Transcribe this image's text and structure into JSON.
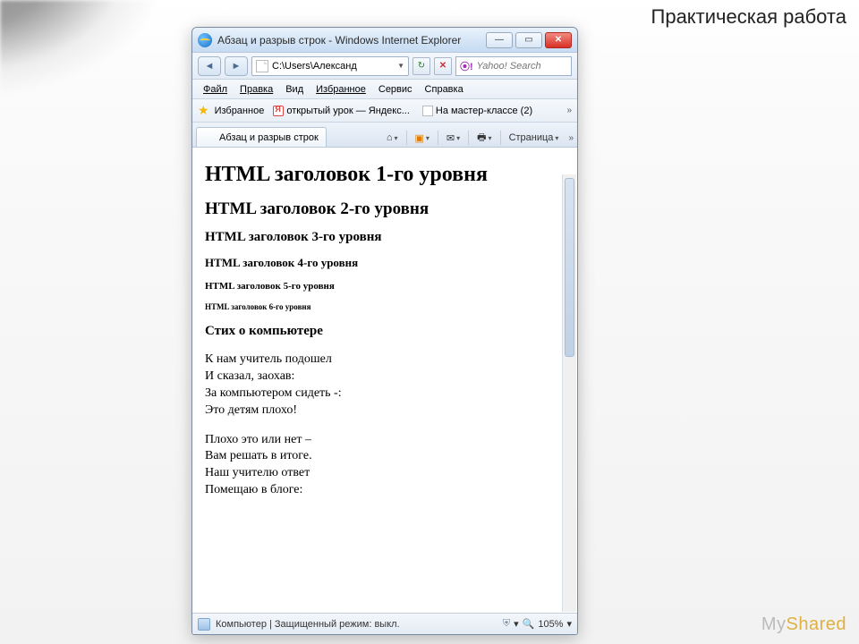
{
  "slide": {
    "title": "Практическая работа",
    "watermark_a": "My",
    "watermark_b": "Shared"
  },
  "window": {
    "title": "Абзац и разрыв строк - Windows Internet Explorer",
    "address": "C:\\Users\\Александ",
    "search_placeholder": "Yahoo! Search"
  },
  "menu": {
    "file": "Файл",
    "edit": "Правка",
    "view": "Вид",
    "fav": "Избранное",
    "tools": "Сервис",
    "help": "Справка"
  },
  "favbar": {
    "label": "Избранное",
    "link1": "открытый урок — Яндекс...",
    "link2": "На мастер-классе (2)"
  },
  "tab": {
    "title": "Абзац и разрыв строк",
    "page_btn": "Страница"
  },
  "page": {
    "h1": "HTML заголовок 1-го уровня",
    "h2": "HTML заголовок 2-го уровня",
    "h3": "HTML заголовок 3-го уровня",
    "h4": "HTML заголовок 4-го уровня",
    "h5": "HTML заголовок 5-го уровня",
    "h6": "HTML заголовок 6-го уровня",
    "sub": "Стих о компьютере",
    "p1": "К нам учитель подошел\nИ сказал, заохав:\nЗа компьютером сидеть -:\nЭто детям плохо!",
    "p2": "Плохо это или нет –\nВам решать в итоге.\nНаш учителю ответ\nПомещаю в блоге:"
  },
  "status": {
    "text": "Компьютер | Защищенный режим: выкл.",
    "zoom": "105%"
  }
}
